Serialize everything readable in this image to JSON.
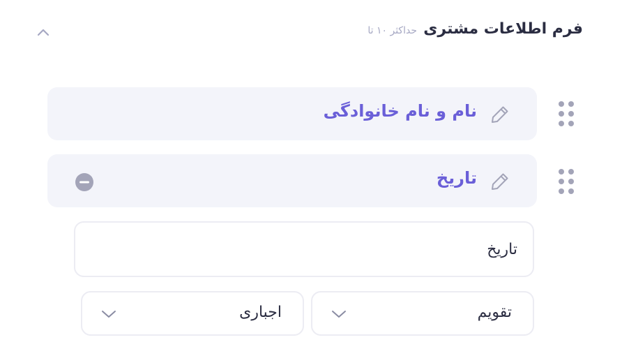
{
  "header": {
    "title": "فرم اطلاعات مشتری",
    "subtitle": "حداکثر ۱۰ تا"
  },
  "fields": [
    {
      "label": "نام و نام خانوادگی"
    },
    {
      "label": "تاریخ"
    }
  ],
  "field_editor": {
    "name_value": "تاریخ",
    "type_select": {
      "value": "تقویم"
    },
    "required_select": {
      "value": "اجباری"
    }
  },
  "colors": {
    "accent": "#6a5fd8",
    "row_background": "#f3f4fa",
    "muted": "#a6a8c3",
    "remove_icon": "#a3a4b8",
    "text": "#2b2d42",
    "border": "#ececf3"
  },
  "icons": {
    "collapse": "chevron-up-icon",
    "edit": "pencil-icon",
    "remove": "minus-circle-icon",
    "drag": "drag-handle-icon",
    "dropdown": "chevron-down-icon"
  }
}
